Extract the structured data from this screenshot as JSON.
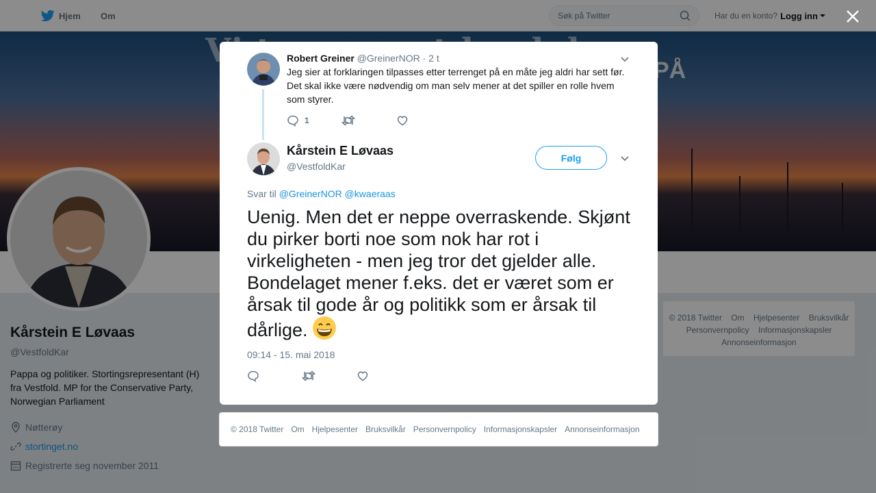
{
  "topbar": {
    "home_label": "Hjem",
    "about_label": "Om",
    "search_placeholder": "Søk på Twitter",
    "account_prompt": "Har du en konto?",
    "login_label": "Logg inn"
  },
  "banner": {
    "text_left": "Vi trenger et land der",
    "text_right": "PÅ"
  },
  "profile": {
    "name": "Kårstein E Løvaas",
    "handle": "@VestfoldKar",
    "bio": "Pappa og politiker. Stortingsrepresentant (H) fra Vestfold. MP for the Conservative Party, Norwegian Parliament",
    "location": "Nøtterøy",
    "website": "stortinget.no",
    "joined": "Registrerte seg november 2011"
  },
  "side_footer": {
    "links": [
      "© 2018 Twitter",
      "Om",
      "Hjelpesenter",
      "Bruksvilkår",
      "Personvernpolicy",
      "Informasjonskapsler",
      "Annonseinformasjon"
    ]
  },
  "parent_tweet": {
    "name": "Robert Greiner",
    "handle": "@GreinerNOR",
    "time": "· 2 t",
    "text": "Jeg sier at forklaringen tilpasses etter terrenget på en måte jeg aldri har sett før. Det skal ikke være nødvendig om man selv mener at det spiller en rolle hvem som styrer.",
    "reply_count": "1"
  },
  "main_tweet": {
    "name": "Kårstein E Løvaas",
    "handle": "@VestfoldKar",
    "follow_label": "Følg",
    "reply_prefix": "Svar til",
    "reply_to_1": "@GreinerNOR",
    "reply_to_2": "@kwaeraas",
    "text": "Uenig. Men det er neppe overraskende. Skjønt du pirker borti noe som nok har rot i virkeligheten - men jeg tror det gjelder alle. Bondelaget mener f.eks. det er været som er årsak til gode år og politikk som er årsak til dårlige.",
    "timestamp": "09:14 - 15. mai 2018"
  },
  "modal_footer": {
    "links": [
      "© 2018 Twitter",
      "Om",
      "Hjelpesenter",
      "Bruksvilkår",
      "Personvernpolicy",
      "Informasjonskapsler",
      "Annonseinformasjon"
    ]
  },
  "colors": {
    "accent": "#1da1f2",
    "link": "#1b95e0",
    "muted": "#657786"
  },
  "icons": [
    "twitter-bird-icon",
    "search-icon",
    "close-icon",
    "reply-icon",
    "retweet-icon",
    "like-icon",
    "chevron-down-icon",
    "location-icon",
    "link-icon",
    "calendar-icon"
  ]
}
